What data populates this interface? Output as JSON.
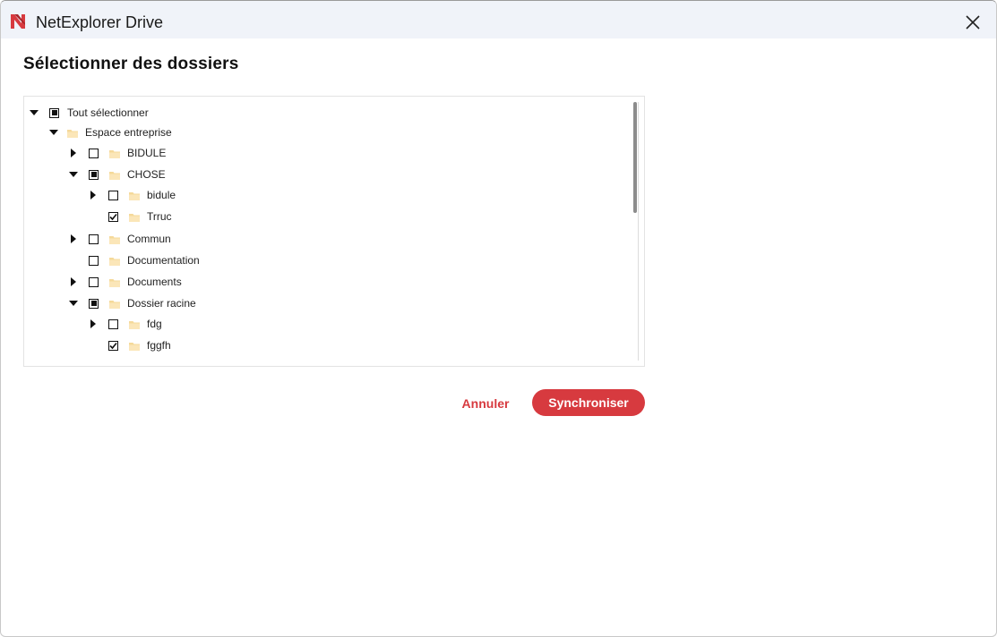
{
  "window": {
    "title": "NetExplorer Drive"
  },
  "dialog": {
    "heading": "Sélectionner des dossiers"
  },
  "tree": {
    "items": [
      {
        "label": "Tout sélectionner",
        "level": 0,
        "expander": "expanded",
        "checkbox": "partial",
        "folder": false
      },
      {
        "label": "Espace entreprise",
        "level": 1,
        "expander": "expanded",
        "checkbox": "none",
        "folder": true
      },
      {
        "label": "BIDULE",
        "level": 2,
        "expander": "collapsed",
        "checkbox": "unchecked",
        "folder": true
      },
      {
        "label": "CHOSE",
        "level": 2,
        "expander": "expanded",
        "checkbox": "partial",
        "folder": true
      },
      {
        "label": "bidule",
        "level": 3,
        "expander": "collapsed",
        "checkbox": "unchecked",
        "folder": true
      },
      {
        "label": "Trruc",
        "level": 3,
        "expander": "none",
        "checkbox": "checked",
        "folder": true
      },
      {
        "label": "Commun",
        "level": 2,
        "expander": "collapsed",
        "checkbox": "unchecked",
        "folder": true
      },
      {
        "label": "Documentation",
        "level": 2,
        "expander": "none",
        "checkbox": "unchecked",
        "folder": true
      },
      {
        "label": "Documents",
        "level": 2,
        "expander": "collapsed",
        "checkbox": "unchecked",
        "folder": true
      },
      {
        "label": "Dossier racine",
        "level": 2,
        "expander": "expanded",
        "checkbox": "partial",
        "folder": true
      },
      {
        "label": "fdg",
        "level": 3,
        "expander": "collapsed",
        "checkbox": "unchecked",
        "folder": true
      },
      {
        "label": "fggfh",
        "level": 3,
        "expander": "none",
        "checkbox": "checked",
        "folder": true
      }
    ]
  },
  "actions": {
    "cancel_label": "Annuler",
    "sync_label": "Synchroniser"
  },
  "colors": {
    "accent": "#d73a3f",
    "titlebar_bg": "#f0f3f9",
    "folder": "#fbe6b8",
    "folder_tab": "#f5d99a"
  }
}
